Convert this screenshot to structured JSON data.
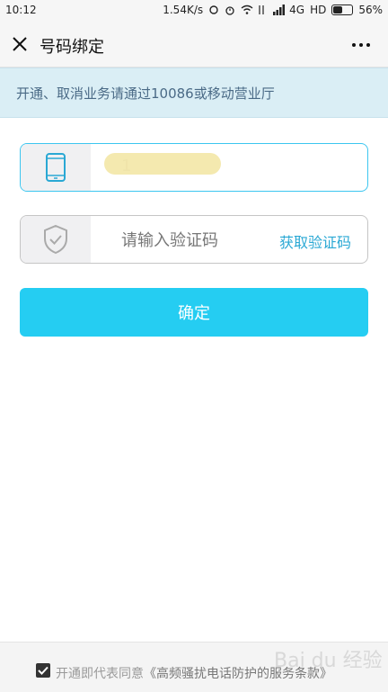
{
  "status_bar": {
    "time": "10:12",
    "speed": "1.54K/s",
    "network": "4G",
    "hd": "HD",
    "battery": "56%",
    "battery_level": 0.56
  },
  "navbar": {
    "title": "号码绑定",
    "close_icon": "close-icon",
    "more_icon": "more-icon"
  },
  "notice": {
    "text": "开通、取消业务请通过10086或移动营业厅"
  },
  "phone_field": {
    "icon": "phone-icon",
    "value": "1"
  },
  "code_field": {
    "icon": "shield-check-icon",
    "placeholder": "请输入验证码",
    "get_code_label": "获取验证码"
  },
  "confirm_button": {
    "label": "确定"
  },
  "footer": {
    "agree_prefix": "开通即代表同意",
    "terms": "《高频骚扰电话防护的服务条款》",
    "checked": true
  },
  "watermark": {
    "text": "Bai du 经验"
  },
  "colors": {
    "accent": "#25cdf2",
    "focus_border": "#3cc6f0",
    "notice_bg": "#daeef5",
    "link": "#2aa8d4"
  }
}
